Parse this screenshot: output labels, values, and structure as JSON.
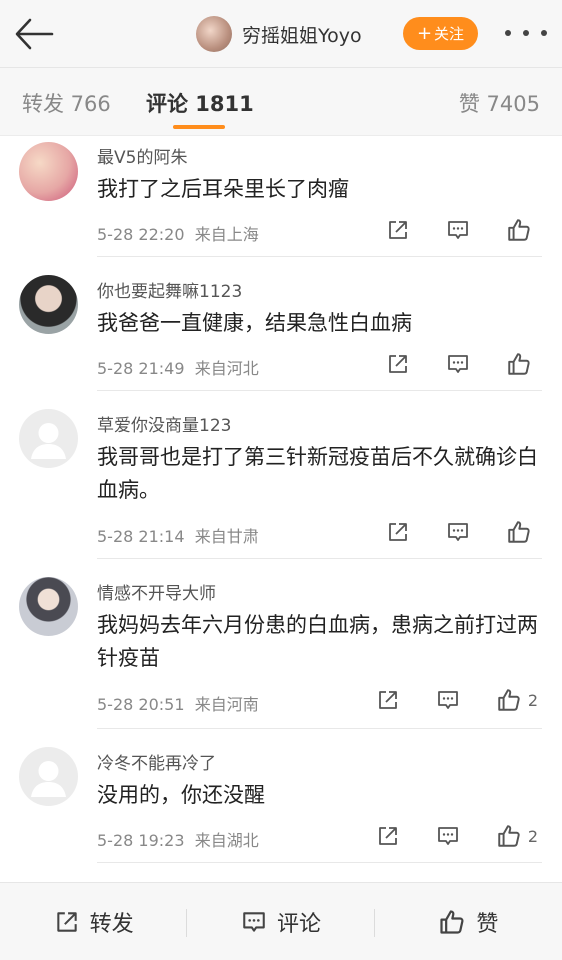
{
  "header": {
    "username": "穷摇姐姐Yoyo",
    "follow_label": "关注",
    "follow_plus": "+",
    "back_icon": "arrow-left-icon",
    "more_icon": "more-dots-icon"
  },
  "tabs": {
    "forward": "转发 766",
    "comment": "评论 1811",
    "like": "赞 7405",
    "active_color": "#ff8d1c"
  },
  "comments": [
    {
      "name": "最V5的阿朱",
      "text": "我打了之后耳朵里长了肉瘤",
      "time": "5-28 22:20",
      "location": "来自上海",
      "likes": ""
    },
    {
      "name": "你也要起舞嘛1123",
      "text": "我爸爸一直健康，结果急性白血病",
      "time": "5-28 21:49",
      "location": "来自河北",
      "likes": ""
    },
    {
      "name": "草爱你没商量123",
      "text": "我哥哥也是打了第三针新冠疫苗后不久就确诊白血病。",
      "time": "5-28 21:14",
      "location": "来自甘肃",
      "likes": ""
    },
    {
      "name": "情感不开导大师",
      "text": "我妈妈去年六月份患的白血病，患病之前打过两针疫苗",
      "time": "5-28 20:51",
      "location": "来自河南",
      "likes": "2"
    },
    {
      "name": "冷冬不能再冷了",
      "text": "没用的，你还没醒",
      "time": "5-28 19:23",
      "location": "来自湖北",
      "likes": "2"
    }
  ],
  "bottom_bar": {
    "forward_label": "转发",
    "comment_label": "评论",
    "like_label": "赞"
  }
}
